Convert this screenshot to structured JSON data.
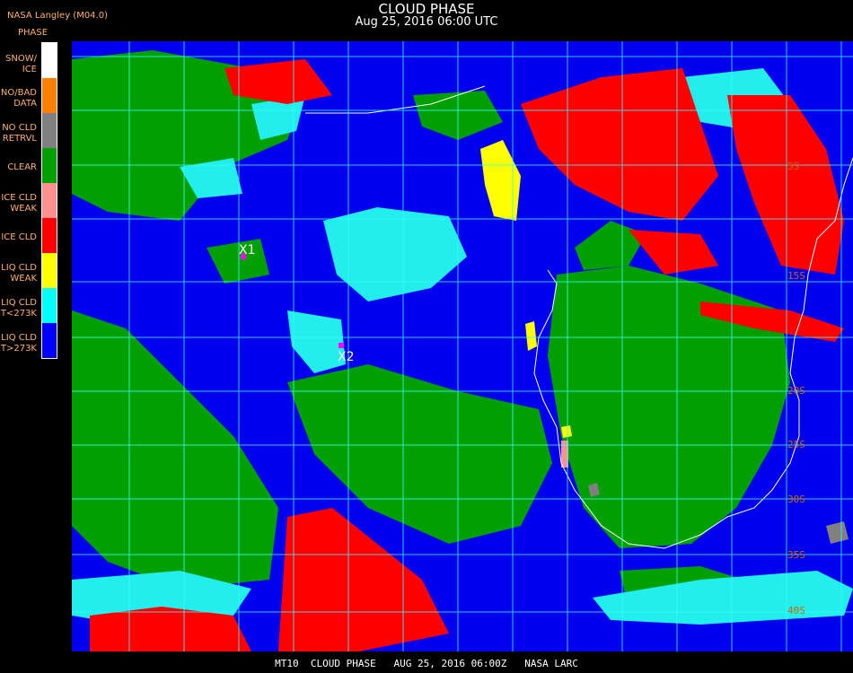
{
  "header": {
    "title": "CLOUD PHASE",
    "subtitle": "Aug 25, 2016 06:00 UTC",
    "provider": "NASA Langley (M04.0)"
  },
  "legend": {
    "title": "PHASE",
    "items": [
      {
        "label": "SNOW/\nICE",
        "color": "#ffffff"
      },
      {
        "label": "NO/BAD\nDATA",
        "color": "#ff7f00"
      },
      {
        "label": "NO CLD\nRETRVL",
        "color": "#808080"
      },
      {
        "label": "CLEAR",
        "color": "#00a000"
      },
      {
        "label": "ICE CLD\nWEAK",
        "color": "#ff9090"
      },
      {
        "label": "ICE CLD",
        "color": "#ff0000"
      },
      {
        "label": "LIQ CLD\nWEAK",
        "color": "#ffff00"
      },
      {
        "label": "LIQ CLD\nT<273K",
        "color": "#00ffff"
      },
      {
        "label": "LIQ CLD\nT>273K",
        "color": "#0000ff"
      }
    ]
  },
  "markers": [
    {
      "label": "X1",
      "color": "#ff00ff"
    },
    {
      "label": "X2",
      "color": "#ff00ff"
    }
  ],
  "lat_labels": [
    "5S",
    "15S",
    "20S",
    "25S",
    "30S",
    "35S",
    "40S"
  ],
  "footer": "MT10  CLOUD PHASE   AUG 25, 2016 06:00Z   NASA LARC",
  "colors": {
    "grid": "#33ffff",
    "coast": "#ffffff",
    "lat_label": "#cc6600"
  }
}
